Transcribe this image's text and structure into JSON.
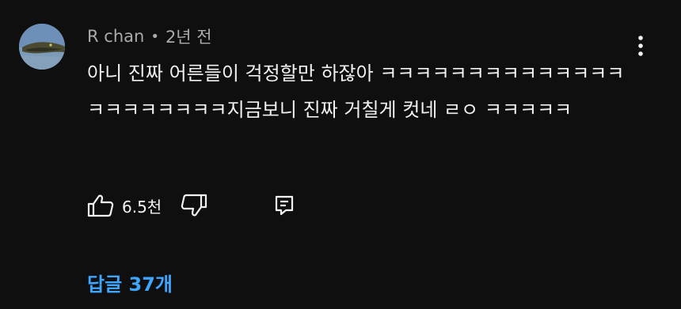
{
  "comment": {
    "author": "R chan",
    "separator": "•",
    "time": "2년 전",
    "text": "아니 진짜 어른들이 걱정할만 하잖아 ㅋㅋㅋㅋㅋㅋㅋㅋㅋㅋㅋㅋㅋㅋㅋㅋㅋㅋㅋㅋㅋㅋ지금보니 진짜 거칠게 컷네 ㄹㅇ ㅋㅋㅋㅋㅋ",
    "like_count": "6.5천",
    "replies_label": "답글 37개"
  },
  "icons": {
    "more": "more-vertical-icon",
    "like": "thumbs-up-icon",
    "dislike": "thumbs-down-icon",
    "reply": "reply-comment-icon"
  },
  "colors": {
    "background": "#0f0f0f",
    "text": "#f1f1f1",
    "secondary_text": "#aaaaaa",
    "link": "#3ea6ff"
  }
}
